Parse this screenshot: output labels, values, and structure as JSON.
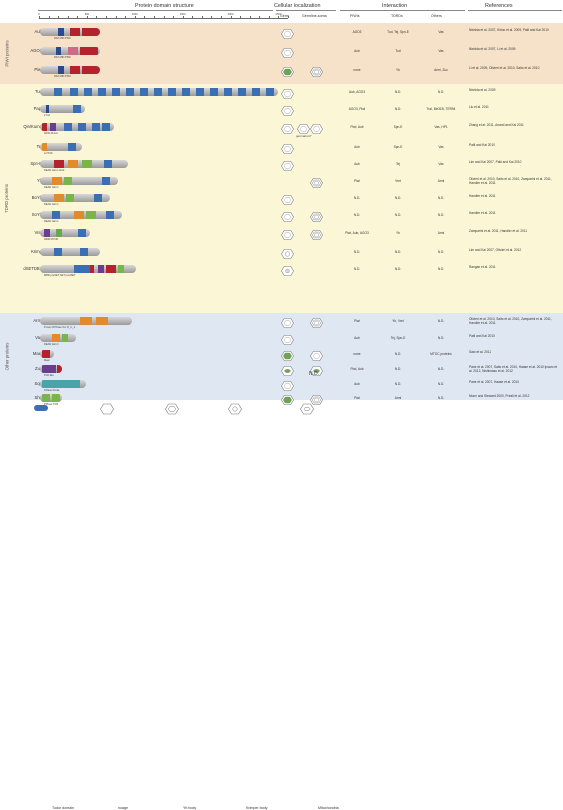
{
  "headers": {
    "domain_structure": "Protein domain structure",
    "cellular_localization": "Cellular localization",
    "interaction": "Interaction",
    "references": "References",
    "germ": "Germ",
    "germline_soma": "Germline-soma",
    "piwis": "PIWIs",
    "tdrds": "TDRDs",
    "others": "Others"
  },
  "scale_ticks": [
    "0",
    "100",
    "200",
    "300",
    "400",
    "500",
    "600",
    "700",
    "800",
    "900",
    "1000",
    "1100",
    "1200",
    "1300",
    "1400",
    "1500",
    "1600",
    "1700",
    "1800",
    "1900",
    "2000",
    "2100",
    "2200",
    "2300",
    "2400",
    "2500",
    "2600"
  ],
  "groups": [
    {
      "label": "PIWI proteins",
      "color": "#f6e2c9"
    },
    {
      "label": "TDRD proteins",
      "color": "#fbf6d6"
    },
    {
      "label": "Other proteins",
      "color": "#dfe7f2"
    }
  ],
  "proteins": [
    {
      "name": "Aub",
      "labels": "PAZ    MID    PIWI",
      "piwis": "AGO3",
      "tdrds": "Tud, Tej, Spn-E",
      "others": "Vas",
      "ref": "Nishida et al. 2007, Kirino et al. 2009, Patil and Kai 2010",
      "germ": "nuage",
      "soma": ""
    },
    {
      "name": "AGO3",
      "labels": "PAZ    MID    PIWI",
      "piwis": "Aub",
      "tdrds": "Tud",
      "others": "Vas",
      "ref": "Nishida et al. 2007, Li et al. 2009",
      "germ": "nuage",
      "soma": ""
    },
    {
      "name": "Piwi",
      "labels": "PAZ    MID    PIWI",
      "piwis": "none",
      "tdrds": "Yb",
      "others": "Armi, Zuc",
      "ref": "Li et al. 2009, Olivieri et al. 2010, Saito et al. 2010",
      "germ": "nuage+yb",
      "soma": "yb"
    },
    {
      "name": "Tud",
      "labels": "",
      "piwis": "Aub, AGO3",
      "tdrds": "N.D.",
      "others": "N.D.",
      "ref": "Nishida et al. 2009",
      "germ": "nuage",
      "soma": ""
    },
    {
      "name": "Papi",
      "labels": "2 KH",
      "piwis": "AGO3, Piwi",
      "tdrds": "N.D.",
      "others": "Tral, Me31B, TER94",
      "ref": "Liu et al. 2011",
      "germ": "nuage",
      "soma": ""
    },
    {
      "name": "Qin/Kumo",
      "labels": "RING  B-box",
      "piwis": "Piwi, Aub",
      "tdrds": "Spn-E",
      "others": "Vas, HP1",
      "ref": "Zhang et al. 2011, Anand and Kai 2011",
      "germ": "nuage",
      "soma": "nuage",
      "soma_note": "germarium*"
    },
    {
      "name": "Tej",
      "labels": "LOTUS",
      "piwis": "Aub",
      "tdrds": "Spn-E",
      "others": "Vas",
      "ref": "Patil and Kai 2010",
      "germ": "nuage",
      "soma": ""
    },
    {
      "name": "Spn-E",
      "labels": "DEAD   Hel-C    HA2",
      "piwis": "Aub",
      "tdrds": "Tej",
      "others": "Vas",
      "ref": "Lim and Kai 2007, Patil and Kai 2010",
      "germ": "nuage",
      "soma": ""
    },
    {
      "name": "Yb",
      "labels": "DEAD   Hel-C",
      "piwis": "Piwi",
      "tdrds": "Vret",
      "others": "Armi",
      "ref": "Olivieri et al. 2010, Saito et al. 2010, Zamparini et al. 2011, Handler et al. 2011",
      "germ": "",
      "soma": "yb"
    },
    {
      "name": "BoYb",
      "labels": "DEAD   Hel-C",
      "piwis": "N.D.",
      "tdrds": "N.D.",
      "others": "N.D.",
      "ref": "Handler et al. 2011",
      "germ": "nuage",
      "soma": ""
    },
    {
      "name": "SoYb",
      "labels": "DEAD   Hel-C",
      "piwis": "N.D.",
      "tdrds": "N.D.",
      "others": "N.D.",
      "ref": "Handler et al. 2011",
      "germ": "nuage",
      "soma": "yb"
    },
    {
      "name": "Vret",
      "labels": "RRM    MYND",
      "piwis": "Piwi, Aub, AGO3",
      "tdrds": "Yb",
      "others": "Armi",
      "ref": "Zamparini et al. 2011, Handler et al. 2011",
      "germ": "nuage",
      "soma": "yb"
    },
    {
      "name": "Krimp",
      "labels": "",
      "piwis": "N.D.",
      "tdrds": "N.D.",
      "others": "N.D.",
      "ref": "Lim and Kai 2007, Olivieri et al. 2012",
      "germ": "krimper",
      "soma": ""
    },
    {
      "name": "dSETDB1",
      "labels": "MBD  preSET  SET  postSET",
      "piwis": "N.D.",
      "tdrds": "N.D.",
      "others": "N.D.",
      "ref": "Rangan et al. 2011",
      "germ": "nucleus",
      "soma": ""
    },
    {
      "name": "Armi",
      "labels": "P-loop NTPase  Uvr D_C_2",
      "piwis": "Piwi",
      "tdrds": "Yb, Vret",
      "others": "N.D.",
      "ref": "Olivieri et al. 2010, Saito et al. 2010, Zamparini et al. 2011, Handler et al. 2011",
      "germ": "nuage",
      "soma": "yb"
    },
    {
      "name": "Vas",
      "labels": "DEAD   Hel-C",
      "piwis": "Aub",
      "tdrds": "Tej, Spn-E",
      "others": "N.D.",
      "ref": "Patil and Kai 2010",
      "germ": "nuage",
      "soma": ""
    },
    {
      "name": "Mael",
      "labels": "Mael",
      "piwis": "none",
      "tdrds": "N.D.",
      "others": "MTOC proteins",
      "ref": "Sato et al. 2011",
      "germ": "nuage+yb",
      "soma": "nuage"
    },
    {
      "name": "Zuc",
      "labels": "PLD-like",
      "piwis": "Piwi, Aub",
      "tdrds": "N.D.",
      "others": "N.D.",
      "ref": "Pane et al. 2007, Saito et al. 2010, Haase et al. 2010 Ipsaro et al. 2012, Nishimasu et al. 2012",
      "germ": "mito",
      "soma": "mito"
    },
    {
      "name": "Squ",
      "labels": "DNase III-like",
      "piwis": "Aub",
      "tdrds": "N.D.",
      "others": "N.D.",
      "ref": "Pane et al. 2007, Haase et al. 2010",
      "germ": "nuage",
      "soma": "nd"
    },
    {
      "name": "Shu",
      "labels": "PPIase   TPR",
      "piwis": "Piwi",
      "tdrds": "Armi",
      "others": "N.D.",
      "ref": "Munn and Steward 2000, Preall et al. 2012",
      "germ": "nuage+yb",
      "soma": "yb"
    }
  ],
  "soma_nd": "N.D.",
  "legend": [
    "Tudor domain",
    "nuage",
    "Yb body",
    "Krimper body",
    "Mitochondria"
  ],
  "colors": {
    "tudor": "#3a6fb3",
    "piwi_red": "#b2232b",
    "piwi_pink": "#d06a86",
    "paz_blue": "#2a4a8f",
    "orange": "#e38a2a",
    "green": "#7ab54a",
    "yb_green": "#6aa84f",
    "purple": "#6b3d8f",
    "teal": "#49a3a8"
  }
}
